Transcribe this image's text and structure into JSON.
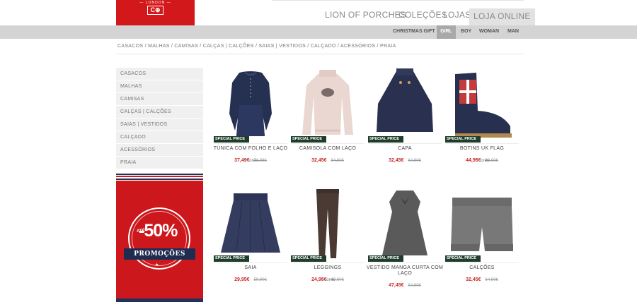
{
  "brand": {
    "logo_subtext": "— LONDON —",
    "logo_mark": "C⊕",
    "color": "#d3181b"
  },
  "main_nav": [
    {
      "label": "LION OF PORCHES"
    },
    {
      "label": "COLEÇÕES"
    },
    {
      "label": "LOJAS"
    },
    {
      "label": "LOJA ONLINE",
      "active": true
    }
  ],
  "sub_nav": [
    {
      "label": "CHRISTMAS GIFT"
    },
    {
      "label": "GIRL",
      "active": true
    },
    {
      "label": "BOY"
    },
    {
      "label": "WOMAN"
    },
    {
      "label": "MAN"
    }
  ],
  "breadcrumb": "CASACOS / MALHAS / CAMISAS / CALÇAS | CALÇÕES / SAIAS | VESTIDOS / CALÇADO / ACESSÓRIOS / PRAIA",
  "sidebar": [
    {
      "label": "CASACOS"
    },
    {
      "label": "MALHAS"
    },
    {
      "label": "CAMISAS"
    },
    {
      "label": "CALÇAS | CALÇÕES"
    },
    {
      "label": "SAIAS | VESTIDOS"
    },
    {
      "label": "CALÇADO"
    },
    {
      "label": "ACESSÓRIOS"
    },
    {
      "label": "PRAIA"
    }
  ],
  "promo": {
    "ate": "ATÉ",
    "percent": "-50%",
    "label": "PROMOÇÕES",
    "star": "★"
  },
  "products": [
    {
      "tag": "SPECIAL PRICE",
      "name": "TÚNICA COM FOLHO E LAÇO",
      "price": "37,49€",
      "old_price": "74,98€",
      "cores": "+ cores"
    },
    {
      "tag": "SPECIAL PRICE",
      "name": "CAMISOLA COM LAÇO",
      "price": "32,45€",
      "old_price": "64,90€",
      "cores": ""
    },
    {
      "tag": "SPECIAL PRICE",
      "name": "CAPA",
      "price": "32,45€",
      "old_price": "64,90€",
      "cores": ""
    },
    {
      "tag": "SPECIAL PRICE",
      "name": "BOTINS UK FLAG",
      "price": "44,95€",
      "old_price": "89,90€",
      "cores": "+ cores"
    },
    {
      "tag": "SPECIAL PRICE",
      "name": "SAIA",
      "price": "29,95€",
      "old_price": "59,90€",
      "cores": ""
    },
    {
      "tag": "SPECIAL PRICE",
      "name": "LEGGINGS",
      "price": "24,95€",
      "old_price": "49,90€",
      "cores": "+ cores"
    },
    {
      "tag": "SPECIAL PRICE",
      "name": "VESTIDO MANGA CURTA COM LAÇO",
      "price": "47,45€",
      "old_price": "94,90€",
      "cores": ""
    },
    {
      "tag": "SPECIAL PRICE",
      "name": "CALÇÕES",
      "price": "32,45€",
      "old_price": "64,90€",
      "cores": ""
    }
  ]
}
